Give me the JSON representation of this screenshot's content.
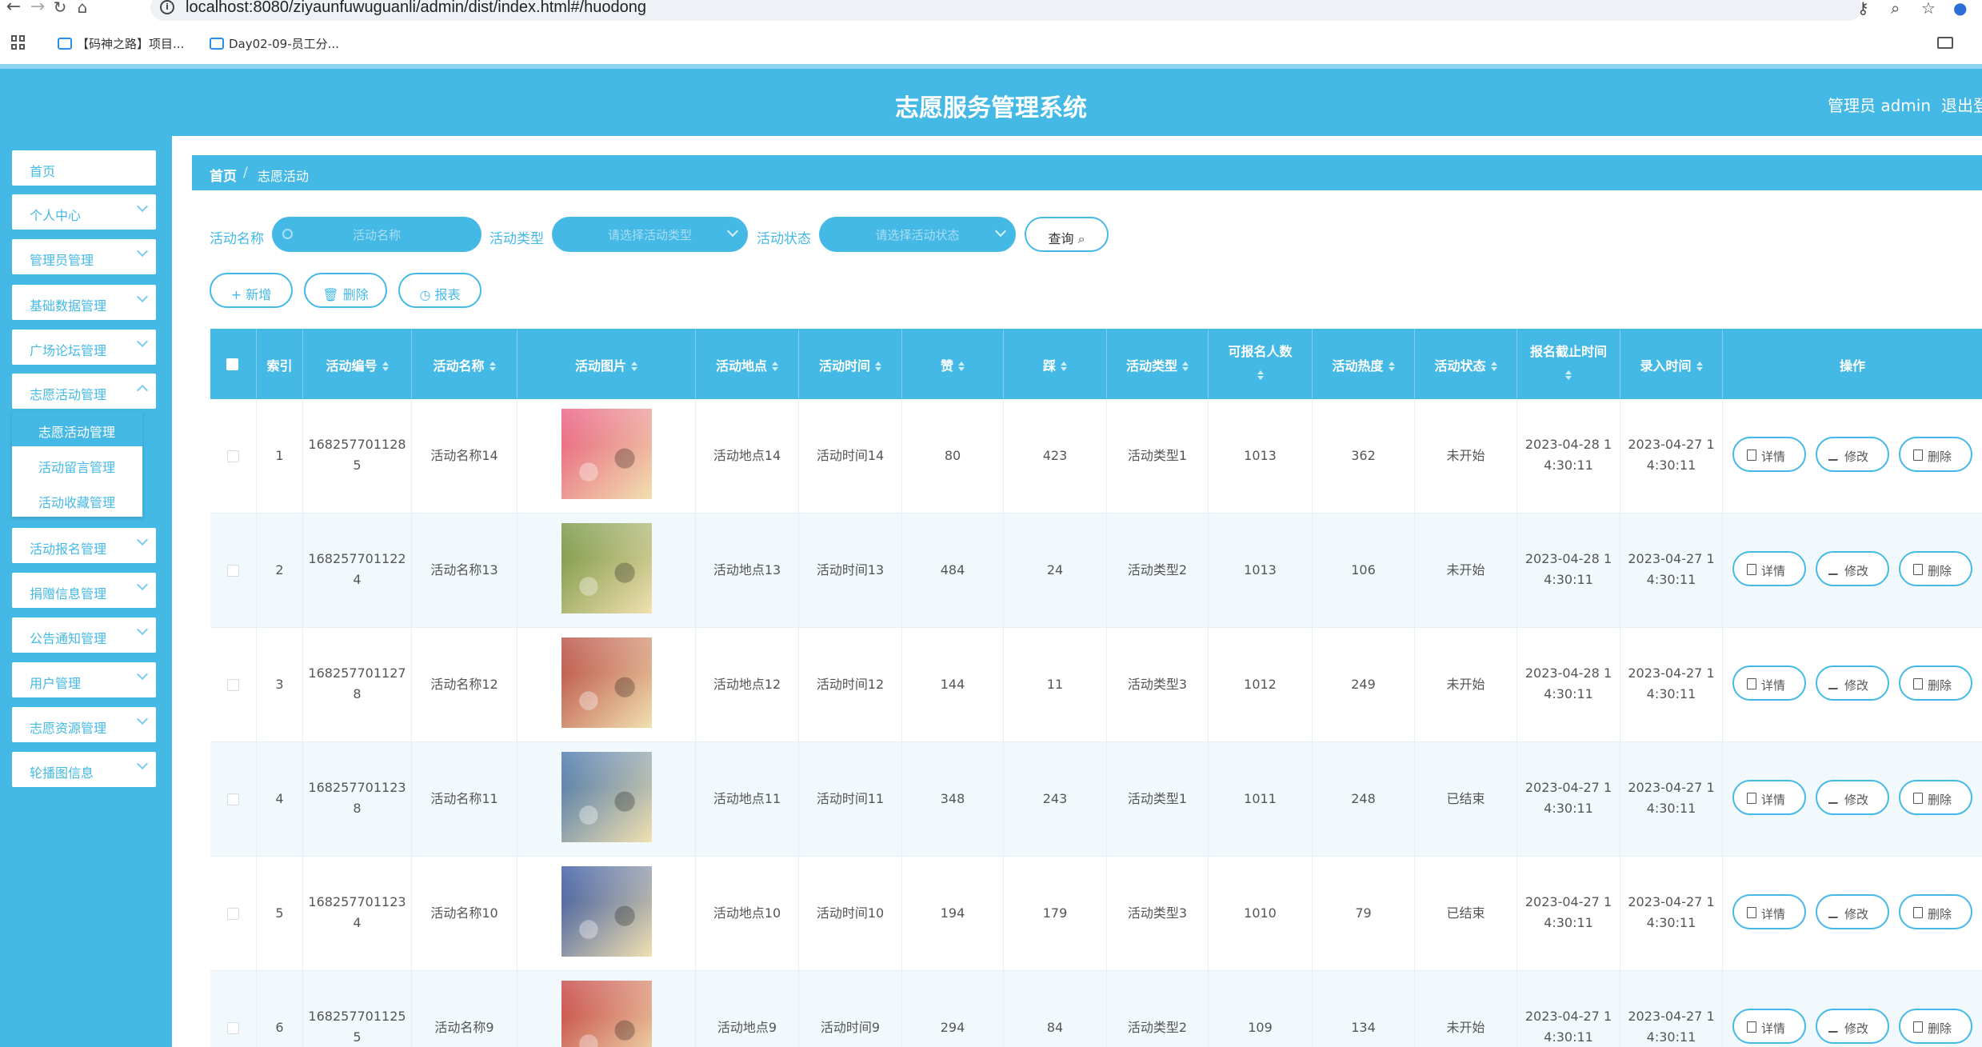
{
  "browser": {
    "url": "localhost:8080/ziyaunfuwuguanli/admin/dist/index.html#/huodong",
    "bookmarks": [
      "【码神之路】项目...",
      "Day02-09-员工分..."
    ]
  },
  "header": {
    "title": "志愿服务管理系统",
    "admin": "管理员 admin",
    "logout": "退出登"
  },
  "sidebar": {
    "items": [
      {
        "label": "首页"
      },
      {
        "label": "个人中心"
      },
      {
        "label": "管理员管理"
      },
      {
        "label": "基础数据管理"
      },
      {
        "label": "广场论坛管理"
      },
      {
        "label": "志愿活动管理"
      },
      {
        "label": "活动报名管理"
      },
      {
        "label": "捐赠信息管理"
      },
      {
        "label": "公告通知管理"
      },
      {
        "label": "用户管理"
      },
      {
        "label": "志愿资源管理"
      },
      {
        "label": "轮播图信息"
      }
    ],
    "submenu": [
      {
        "label": "志愿活动管理"
      },
      {
        "label": "活动留言管理"
      },
      {
        "label": "活动收藏管理"
      }
    ]
  },
  "breadcrumb": {
    "home": "首页",
    "sep": "/",
    "current": "志愿活动"
  },
  "search": {
    "name_label": "活动名称",
    "name_placeholder": "活动名称",
    "type_label": "活动类型",
    "type_placeholder": "请选择活动类型",
    "status_label": "活动状态",
    "status_placeholder": "请选择活动状态",
    "query": "查询"
  },
  "actions": {
    "add": "+ 新增",
    "delete": "删除",
    "report": "报表"
  },
  "table": {
    "headers": {
      "index": "索引",
      "code": "活动编号",
      "name": "活动名称",
      "photo": "活动图片",
      "place": "活动地点",
      "time": "活动时间",
      "zan": "赞",
      "cai": "踩",
      "type": "活动类型",
      "capacity": "可报名人数",
      "heat": "活动热度",
      "status": "活动状态",
      "deadline": "报名截止时间",
      "entry": "录入时间",
      "ops": "操作"
    },
    "op_labels": {
      "detail": "详情",
      "edit": "修改",
      "remove": "删除"
    },
    "rows": [
      {
        "index": "1",
        "code1": "168257701128",
        "code2": "5",
        "name": "活动名称14",
        "place": "活动地点14",
        "time": "活动时间14",
        "zan": "80",
        "cai": "423",
        "type": "活动类型1",
        "capacity": "1013",
        "heat": "362",
        "status": "未开始",
        "deadline1": "2023-04-28 1",
        "deadline2": "4:30:11",
        "entry1": "2023-04-27 1",
        "entry2": "4:30:11"
      },
      {
        "index": "2",
        "code1": "168257701122",
        "code2": "4",
        "name": "活动名称13",
        "place": "活动地点13",
        "time": "活动时间13",
        "zan": "484",
        "cai": "24",
        "type": "活动类型2",
        "capacity": "1013",
        "heat": "106",
        "status": "未开始",
        "deadline1": "2023-04-28 1",
        "deadline2": "4:30:11",
        "entry1": "2023-04-27 1",
        "entry2": "4:30:11"
      },
      {
        "index": "3",
        "code1": "168257701127",
        "code2": "8",
        "name": "活动名称12",
        "place": "活动地点12",
        "time": "活动时间12",
        "zan": "144",
        "cai": "11",
        "type": "活动类型3",
        "capacity": "1012",
        "heat": "249",
        "status": "未开始",
        "deadline1": "2023-04-28 1",
        "deadline2": "4:30:11",
        "entry1": "2023-04-27 1",
        "entry2": "4:30:11"
      },
      {
        "index": "4",
        "code1": "168257701123",
        "code2": "8",
        "name": "活动名称11",
        "place": "活动地点11",
        "time": "活动时间11",
        "zan": "348",
        "cai": "243",
        "type": "活动类型1",
        "capacity": "1011",
        "heat": "248",
        "status": "已结束",
        "deadline1": "2023-04-27 1",
        "deadline2": "4:30:11",
        "entry1": "2023-04-27 1",
        "entry2": "4:30:11"
      },
      {
        "index": "5",
        "code1": "168257701123",
        "code2": "4",
        "name": "活动名称10",
        "place": "活动地点10",
        "time": "活动时间10",
        "zan": "194",
        "cai": "179",
        "type": "活动类型3",
        "capacity": "1010",
        "heat": "79",
        "status": "已结束",
        "deadline1": "2023-04-27 1",
        "deadline2": "4:30:11",
        "entry1": "2023-04-27 1",
        "entry2": "4:30:11"
      },
      {
        "index": "6",
        "code1": "168257701125",
        "code2": "5",
        "name": "活动名称9",
        "place": "活动地点9",
        "time": "活动时间9",
        "zan": "294",
        "cai": "84",
        "type": "活动类型2",
        "capacity": "109",
        "heat": "134",
        "status": "未开始",
        "deadline1": "2023-04-27 1",
        "deadline2": "4:30:11",
        "entry1": "2023-04-27 1",
        "entry2": "4:30:11"
      }
    ]
  },
  "photo_colors": [
    "#e8567a",
    "#6e8f3a",
    "#b5433a",
    "#3f6fa8",
    "#2d4f9e",
    "#c23a3a"
  ],
  "theme": {
    "primary": "#45b9e6",
    "white": "#ffffff"
  }
}
